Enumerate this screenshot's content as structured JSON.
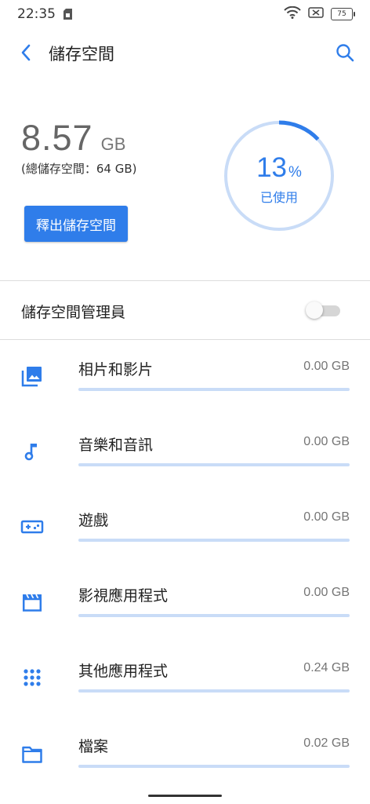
{
  "status_bar": {
    "time": "22:35",
    "battery": "75"
  },
  "app_bar": {
    "title": "儲存空間"
  },
  "summary": {
    "used_value": "8.57",
    "used_unit": "GB",
    "total_text": "(總儲存空間：64 GB)",
    "free_button": "釋出儲存空間",
    "percent_value": "13",
    "percent_sign": "%",
    "percent_label": "已使用",
    "percent_used": 0.13
  },
  "storage_manager": {
    "label": "儲存空間管理員",
    "enabled": false
  },
  "categories": [
    {
      "icon": "photo-icon",
      "name": "相片和影片",
      "size": "0.00 GB",
      "fraction": 0.0
    },
    {
      "icon": "music-note-icon",
      "name": "音樂和音訊",
      "size": "0.00 GB",
      "fraction": 0.0
    },
    {
      "icon": "gamepad-icon",
      "name": "遊戲",
      "size": "0.00 GB",
      "fraction": 0.0
    },
    {
      "icon": "movie-icon",
      "name": "影視應用程式",
      "size": "0.00 GB",
      "fraction": 0.0
    },
    {
      "icon": "apps-grid-icon",
      "name": "其他應用程式",
      "size": "0.24 GB",
      "fraction": 0.0
    },
    {
      "icon": "folder-icon",
      "name": "檔案",
      "size": "0.02 GB",
      "fraction": 0.0
    }
  ],
  "colors": {
    "accent": "#2f7dea",
    "track": "#c9dcf7"
  }
}
